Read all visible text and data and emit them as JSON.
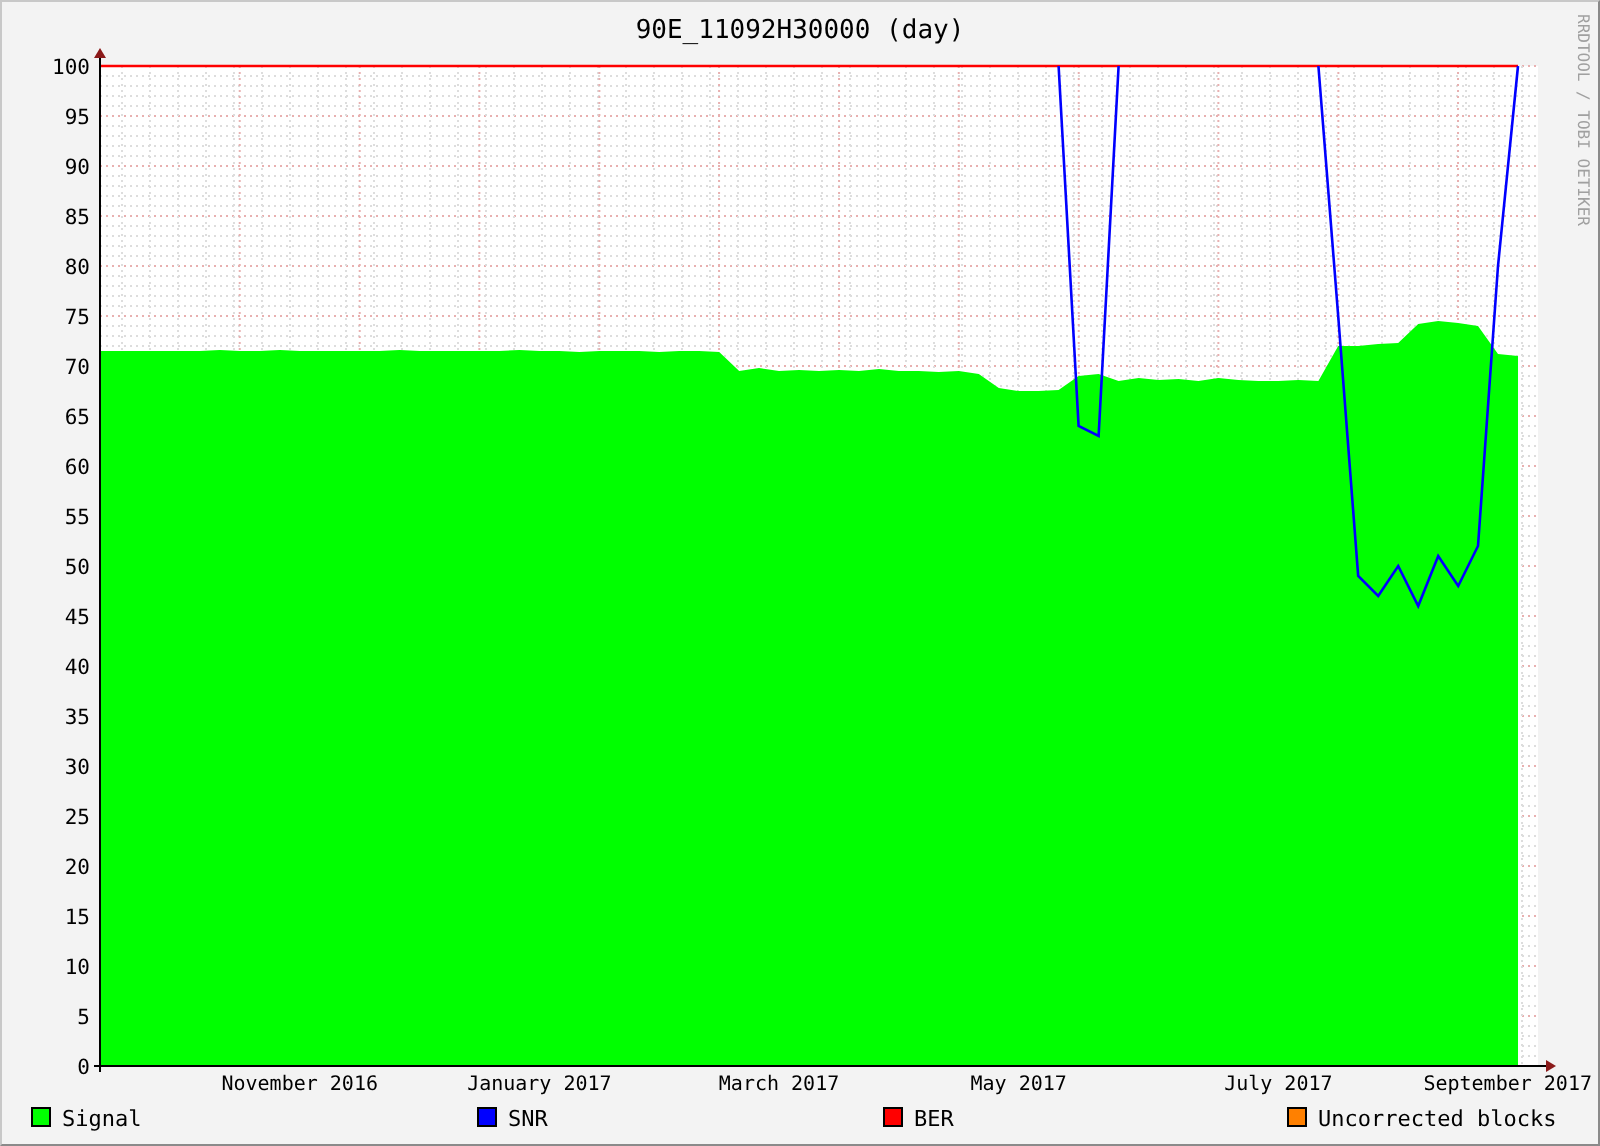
{
  "title": "90E_11092H30000 (day)",
  "side_label": "RRDTOOL / TOBI OETIKER",
  "chart_data": {
    "type": "area",
    "categories": [
      null,
      null,
      null,
      null,
      null,
      null,
      null,
      null,
      null,
      null,
      "November 2016",
      null,
      null,
      null,
      null,
      null,
      null,
      null,
      null,
      null,
      null,
      null,
      "January 2017",
      null,
      null,
      null,
      null,
      null,
      null,
      null,
      null,
      null,
      null,
      null,
      "March 2017",
      null,
      null,
      null,
      null,
      null,
      null,
      null,
      null,
      null,
      null,
      null,
      "May 2017",
      null,
      null,
      null,
      null,
      null,
      null,
      null,
      null,
      null,
      null,
      null,
      null,
      "July 2017",
      null,
      null,
      null,
      null,
      null,
      null,
      null,
      null,
      null,
      null,
      null,
      "September 2017"
    ],
    "ylim": [
      0,
      100
    ],
    "grid": true,
    "yticks": [
      0,
      5,
      10,
      15,
      20,
      25,
      30,
      35,
      40,
      45,
      50,
      55,
      60,
      65,
      70,
      75,
      80,
      85,
      90,
      95,
      100
    ],
    "series": [
      {
        "name": "Signal",
        "color": "#00ff00",
        "values": [
          71.5,
          71.5,
          71.5,
          71.5,
          71.5,
          71.5,
          71.6,
          71.5,
          71.5,
          71.6,
          71.5,
          71.5,
          71.5,
          71.5,
          71.5,
          71.6,
          71.5,
          71.5,
          71.5,
          71.5,
          71.5,
          71.6,
          71.5,
          71.5,
          71.4,
          71.5,
          71.5,
          71.5,
          71.4,
          71.5,
          71.5,
          71.4,
          69.5,
          69.8,
          69.5,
          69.6,
          69.5,
          69.6,
          69.5,
          69.7,
          69.5,
          69.5,
          69.4,
          69.5,
          69.2,
          67.8,
          67.5,
          67.5,
          67.6,
          69,
          69.2,
          68.5,
          68.8,
          68.6,
          68.7,
          68.5,
          68.8,
          68.6,
          68.5,
          68.5,
          68.6,
          68.5,
          72,
          72,
          72.2,
          72.3,
          74.2,
          74.5,
          74.3,
          74,
          71.2,
          71
        ]
      },
      {
        "name": "SNR",
        "type": "line",
        "color": "#0000ff",
        "values": [
          null,
          null,
          null,
          null,
          null,
          null,
          null,
          null,
          null,
          null,
          null,
          null,
          null,
          null,
          null,
          null,
          null,
          null,
          null,
          null,
          null,
          null,
          null,
          null,
          null,
          null,
          null,
          null,
          null,
          null,
          null,
          null,
          null,
          null,
          null,
          null,
          null,
          null,
          null,
          null,
          null,
          null,
          null,
          null,
          null,
          null,
          null,
          null,
          100,
          64,
          63,
          100,
          null,
          null,
          null,
          null,
          null,
          null,
          null,
          null,
          null,
          100,
          75,
          49,
          47,
          50,
          46,
          51,
          48,
          52,
          80,
          100
        ]
      },
      {
        "name": "BER",
        "type": "line",
        "color": "#ff0000",
        "values": [
          100,
          100,
          100,
          100,
          100,
          100,
          100,
          100,
          100,
          100,
          100,
          100,
          100,
          100,
          100,
          100,
          100,
          100,
          100,
          100,
          100,
          100,
          100,
          100,
          100,
          100,
          100,
          100,
          100,
          100,
          100,
          100,
          100,
          100,
          100,
          100,
          100,
          100,
          100,
          100,
          100,
          100,
          100,
          100,
          100,
          100,
          100,
          100,
          100,
          100,
          100,
          100,
          100,
          100,
          100,
          100,
          100,
          100,
          100,
          100,
          100,
          100,
          100,
          100,
          100,
          100,
          100,
          100,
          100,
          100,
          100,
          100
        ]
      },
      {
        "name": "Uncorrected blocks",
        "type": "line",
        "color": "#ff8000",
        "values": [
          null,
          null,
          null,
          null,
          null,
          null,
          null,
          null,
          null,
          null,
          null,
          null,
          null,
          null,
          null,
          null,
          null,
          null,
          null,
          null,
          null,
          null,
          null,
          null,
          null,
          null,
          null,
          null,
          null,
          null,
          null,
          null,
          null,
          null,
          null,
          null,
          null,
          null,
          null,
          null,
          null,
          null,
          null,
          null,
          null,
          null,
          null,
          null,
          null,
          null,
          null,
          null,
          null,
          null,
          null,
          null,
          null,
          null,
          null,
          null,
          null,
          null,
          null,
          null,
          null,
          null,
          null,
          null,
          null,
          null,
          null,
          null
        ]
      }
    ]
  }
}
